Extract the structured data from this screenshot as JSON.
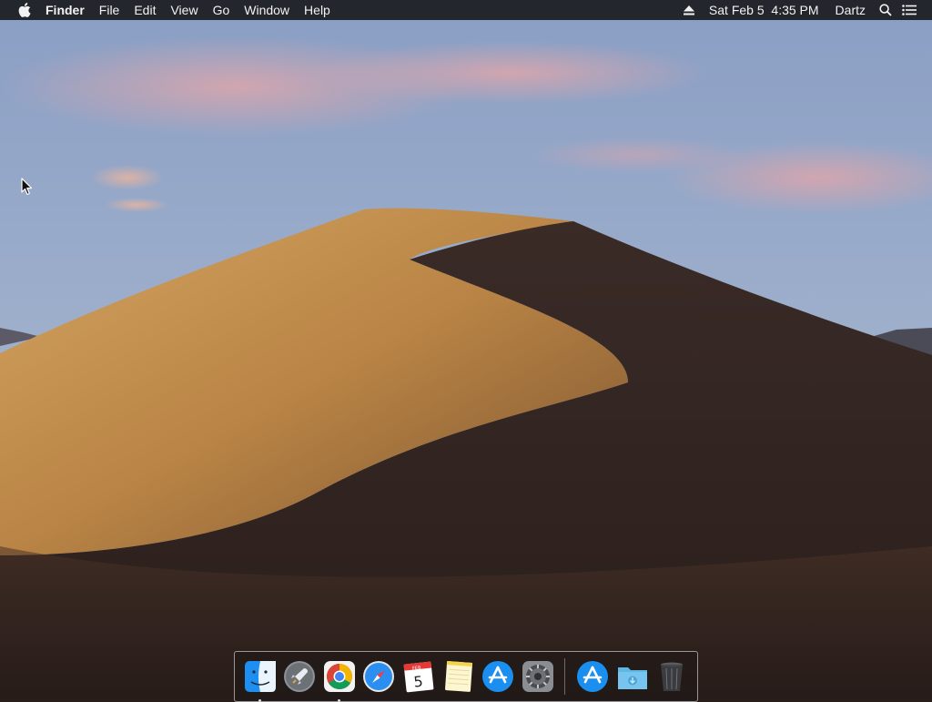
{
  "menubar": {
    "apple_icon": "apple-logo-icon",
    "app_name": "Finder",
    "menus": [
      "File",
      "Edit",
      "View",
      "Go",
      "Window",
      "Help"
    ],
    "status": {
      "eject_icon": "eject-icon",
      "datetime": "Sat Feb 5  4:35 PM",
      "user": "Dartz",
      "spotlight_icon": "search-icon",
      "notification_icon": "list-icon"
    }
  },
  "dock": {
    "apps": [
      {
        "name": "Finder",
        "icon": "finder-icon",
        "running": true
      },
      {
        "name": "Launchpad",
        "icon": "launchpad-icon",
        "running": false
      },
      {
        "name": "Google Chrome",
        "icon": "chrome-icon",
        "running": true
      },
      {
        "name": "Safari",
        "icon": "safari-icon",
        "running": false
      },
      {
        "name": "Calendar",
        "icon": "calendar-icon",
        "running": false,
        "month": "FEB",
        "day": "5"
      },
      {
        "name": "Notes",
        "icon": "notes-icon",
        "running": false
      },
      {
        "name": "App Store",
        "icon": "app-store-icon",
        "running": false
      },
      {
        "name": "System Preferences",
        "icon": "system-preferences-icon",
        "running": false
      }
    ],
    "others": [
      {
        "name": "Applications",
        "icon": "applications-stack-icon"
      },
      {
        "name": "Downloads",
        "icon": "downloads-folder-icon"
      },
      {
        "name": "Trash",
        "icon": "trash-icon"
      }
    ]
  },
  "colors": {
    "menubar_bg": "#161618",
    "sky_top": "#8a9ec4",
    "sky_bottom": "#a8b6cc",
    "dune_light": "#c99a5c",
    "dune_dark": "#3a2a25"
  }
}
